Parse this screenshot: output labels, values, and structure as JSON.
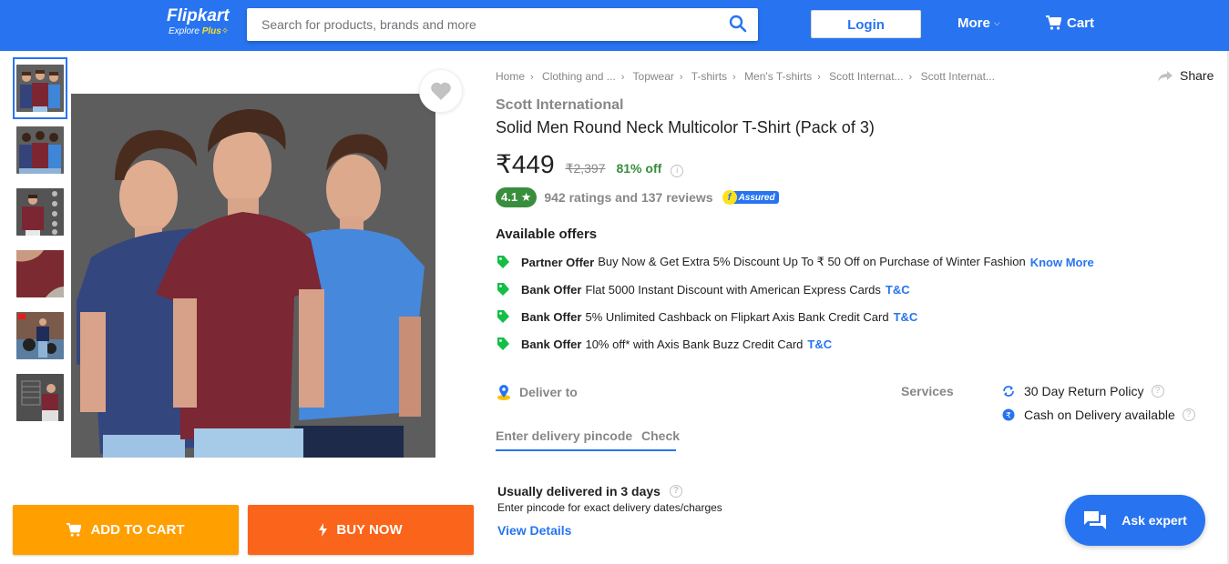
{
  "header": {
    "logo_name": "Flipkart",
    "logo_tag_explore": "Explore",
    "logo_tag_plus": "Plus",
    "search_placeholder": "Search for products, brands and more",
    "search_value": "",
    "login_label": "Login",
    "more_label": "More",
    "cart_label": "Cart"
  },
  "gallery": {
    "thumbnails": [
      {
        "alt": "three men in navy, maroon and blue t-shirts, front"
      },
      {
        "alt": "three men t-shirts, back view"
      },
      {
        "alt": "man in maroon t-shirt with feature icons"
      },
      {
        "alt": "maroon fabric close-up"
      },
      {
        "alt": "man in navy t-shirt with motorcycle"
      },
      {
        "alt": "man in maroon t-shirt with size chart"
      }
    ],
    "active_index": 0,
    "main_image_alt": "Three men wearing navy, maroon and blue round neck t-shirts"
  },
  "actions": {
    "add_to_cart": "ADD TO CART",
    "buy_now": "BUY NOW"
  },
  "breadcrumbs": [
    "Home",
    "Clothing and ...",
    "Topwear",
    "T-shirts",
    "Men's T-shirts",
    "Scott Internat...",
    "Scott Internat..."
  ],
  "share_label": "Share",
  "product": {
    "brand": "Scott International",
    "title": "Solid Men Round Neck Multicolor T-Shirt  (Pack of 3)",
    "price": "₹449",
    "mrp": "₹2,397",
    "discount": "81% off",
    "rating": "4.1",
    "rating_star": "★",
    "ratings_reviews": "942 ratings and 137 reviews",
    "assured_label": "Assured"
  },
  "offers": {
    "heading": "Available offers",
    "items": [
      {
        "type": "Partner Offer",
        "text": "Buy Now & Get Extra 5% Discount Up To ₹ 50 Off on Purchase of Winter Fashion",
        "link": "Know More"
      },
      {
        "type": "Bank Offer",
        "text": "Flat 5000 Instant Discount with American Express Cards",
        "link": "T&C"
      },
      {
        "type": "Bank Offer",
        "text": "5% Unlimited Cashback on Flipkart Axis Bank Credit Card",
        "link": "T&C"
      },
      {
        "type": "Bank Offer",
        "text": "10% off* with Axis Bank Buzz Credit Card",
        "link": "T&C"
      }
    ]
  },
  "delivery": {
    "label": "Deliver to",
    "pincode_placeholder": "Enter delivery pincode",
    "pincode_value": "",
    "check_label": "Check",
    "time": "Usually delivered in 3 days",
    "sub": "Enter pincode for exact delivery dates/charges",
    "view_details": "View Details"
  },
  "services": {
    "label": "Services",
    "items": [
      {
        "icon": "return-icon",
        "text": "30 Day Return Policy"
      },
      {
        "icon": "rupee-icon",
        "text": "Cash on Delivery available"
      }
    ]
  },
  "help_glyph": "?",
  "info_glyph": "i",
  "ask_expert": "Ask expert",
  "colors": {
    "brand_blue": "#2874f0",
    "add_to_cart": "#ff9f00",
    "buy_now": "#fb641b",
    "rating_green": "#388e3c",
    "plus_yellow": "#ffe11b"
  }
}
